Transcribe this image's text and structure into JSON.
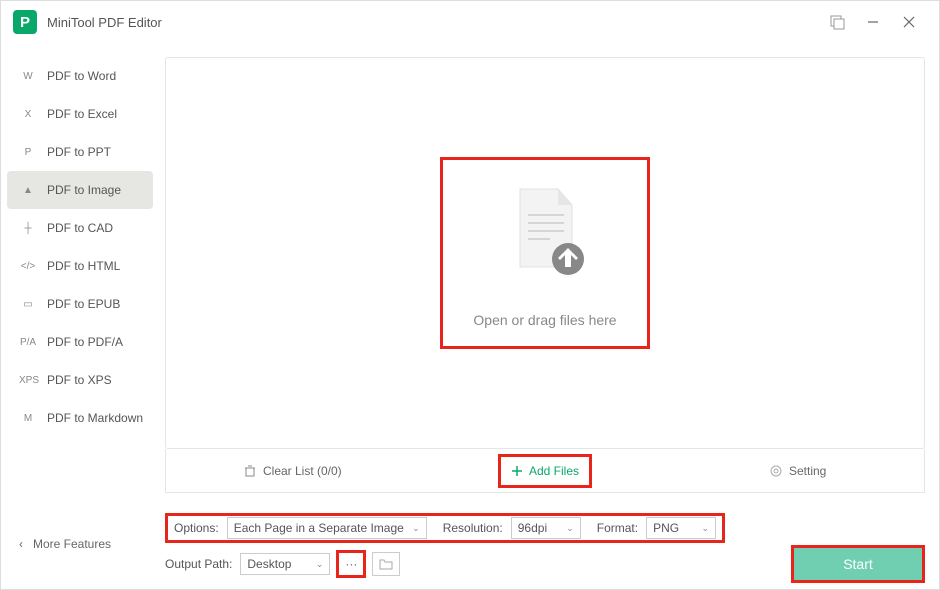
{
  "app": {
    "title": "MiniTool PDF Editor"
  },
  "sidebar": {
    "items": [
      {
        "icon": "W",
        "label": "PDF to Word"
      },
      {
        "icon": "X",
        "label": "PDF to Excel"
      },
      {
        "icon": "P",
        "label": "PDF to PPT"
      },
      {
        "icon": "▲",
        "label": "PDF to Image"
      },
      {
        "icon": "┼",
        "label": "PDF to CAD"
      },
      {
        "icon": "</>",
        "label": "PDF to HTML"
      },
      {
        "icon": "▭",
        "label": "PDF to EPUB"
      },
      {
        "icon": "P/A",
        "label": "PDF to PDF/A"
      },
      {
        "icon": "XPS",
        "label": "PDF to XPS"
      },
      {
        "icon": "M",
        "label": "PDF to Markdown"
      }
    ],
    "more": "More Features"
  },
  "dropzone": {
    "text": "Open or drag files here"
  },
  "actionbar": {
    "clear": "Clear List (0/0)",
    "add": "Add Files",
    "setting": "Setting"
  },
  "options": {
    "options_label": "Options:",
    "options_value": "Each Page in a Separate Image",
    "resolution_label": "Resolution:",
    "resolution_value": "96dpi",
    "format_label": "Format:",
    "format_value": "PNG"
  },
  "output": {
    "label": "Output Path:",
    "value": "Desktop"
  },
  "start": "Start"
}
